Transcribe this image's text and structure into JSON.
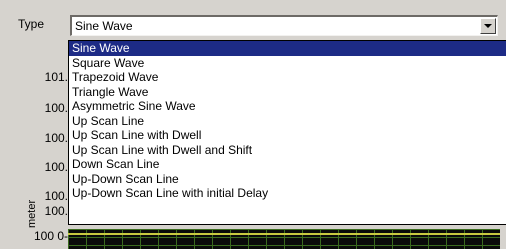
{
  "type_field": {
    "label": "Type",
    "value": "Sine Wave"
  },
  "dropdown": {
    "selected_index": 0,
    "items": [
      "Sine Wave",
      "Square Wave",
      "Trapezoid Wave",
      "Triangle Wave",
      "Asymmetric Sine Wave",
      "Up Scan Line",
      "Up Scan Line with Dwell",
      "Up Scan Line with Dwell and Shift",
      "Down Scan Line",
      "Up-Down Scan Line",
      "Up-Down Scan Line with initial Delay"
    ]
  },
  "graph": {
    "y_axis_title": "meter",
    "y_labels": [
      "101.",
      "100.",
      "100.",
      "100.",
      "100.",
      "100.",
      "100 0-"
    ],
    "colors": {
      "background": "#0a0a0a",
      "grid": "#3b6b1f",
      "trace": "#c8c840",
      "selection": "#1d2b86"
    }
  }
}
